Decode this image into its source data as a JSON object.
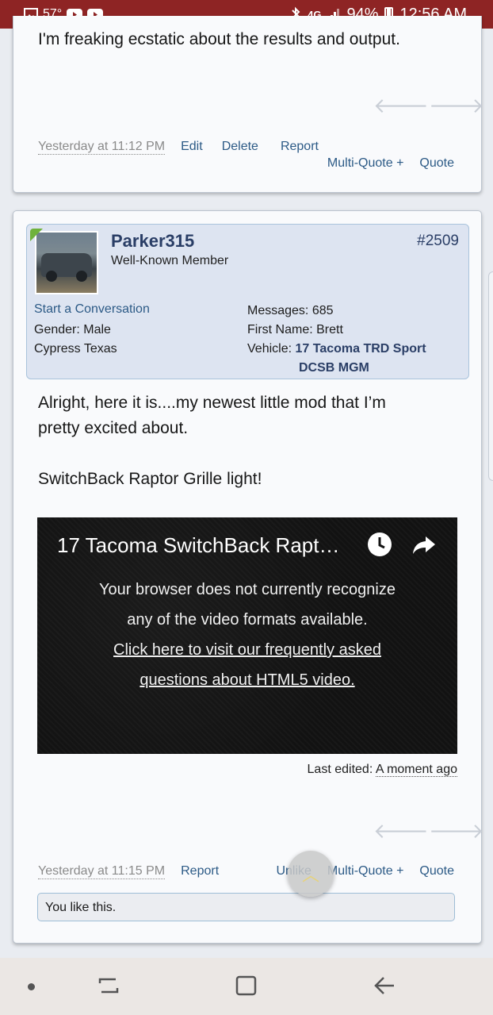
{
  "status_bar": {
    "temperature": "57°",
    "network": "4G",
    "battery": "94%",
    "time": "12:56 AM"
  },
  "post1": {
    "text": "I'm freaking ecstatic about the results and output.",
    "time": "Yesterday at 11:12 PM",
    "actions": {
      "edit": "Edit",
      "delete": "Delete",
      "report": "Report",
      "multiquote": "Multi-Quote +",
      "quote": "Quote"
    }
  },
  "post2": {
    "author": {
      "username": "Parker315",
      "title": "Well-Known Member",
      "post_number": "#2509",
      "start_conversation": "Start a Conversation",
      "gender_label": "Gender:",
      "gender": "Male",
      "location": "Cypress Texas",
      "messages_label": "Messages:",
      "messages": "685",
      "first_name_label": "First Name:",
      "first_name": "Brett",
      "vehicle_label": "Vehicle:",
      "vehicle_line1": "17 Tacoma TRD Sport",
      "vehicle_line2": "DCSB MGM"
    },
    "text_line1": "Alright, here it is....my newest little mod that I’m",
    "text_line2": "pretty excited about.",
    "text_line3": "SwitchBack Raptor Grille light!",
    "video": {
      "title": "17 Tacoma SwitchBack Rapt…",
      "msg_line1": "Your browser does not currently recognize",
      "msg_line2": "any of the video formats available.",
      "link_line1": "Click here to visit our frequently asked",
      "link_line2": "questions about HTML5 video."
    },
    "last_edited_label": "Last edited:",
    "last_edited_value": "A moment ago",
    "time": "Yesterday at 11:15 PM",
    "actions": {
      "report": "Report",
      "unlike": "Unlike",
      "multiquote": "Multi-Quote +",
      "quote": "Quote"
    },
    "like_text": "You like this."
  },
  "colors": {
    "status_bar": "#8e2424",
    "link": "#2c5a86",
    "username": "#2a3e66",
    "author_bg": "#dde4f1"
  }
}
